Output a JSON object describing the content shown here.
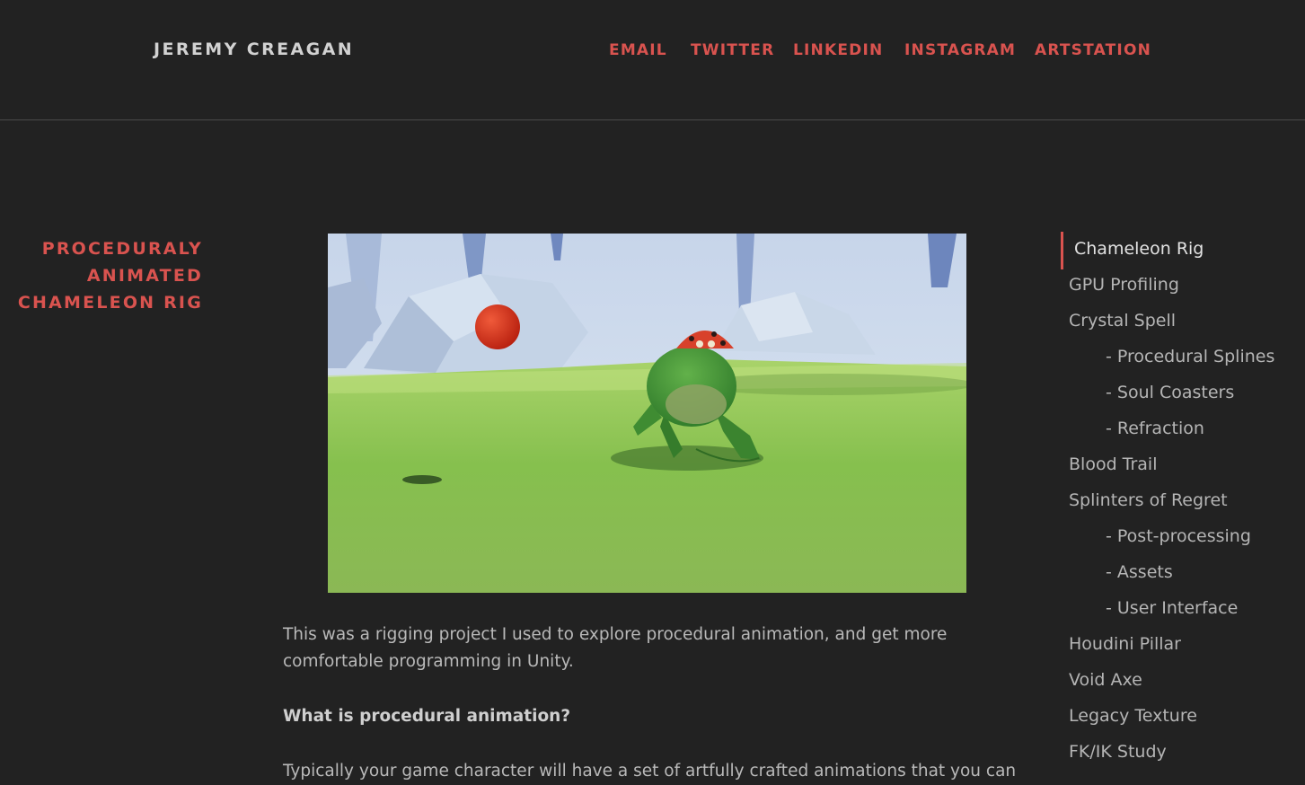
{
  "header": {
    "site_title": "JEREMY CREAGAN",
    "nav": [
      "EMAIL",
      "TWITTER",
      "LINKEDIN",
      "INSTAGRAM",
      "ARTSTATION"
    ]
  },
  "page": {
    "heading_lines": [
      "PROCEDURALY",
      "ANIMATED",
      "CHAMELEON RIG"
    ],
    "hero_image": "chameleon-rig-animation"
  },
  "article": {
    "intro": "This was a rigging project I used to explore procedural animation, and get more comfortable programming in Unity.",
    "question": "What is procedural animation?",
    "para2": "Typically your game character will have a set of artfully crafted animations that you can"
  },
  "toc": {
    "items": [
      {
        "label": "Chameleon Rig",
        "sub": false,
        "active": true
      },
      {
        "label": "GPU Profiling",
        "sub": false,
        "active": false
      },
      {
        "label": "Crystal Spell",
        "sub": false,
        "active": false
      },
      {
        "label": "- Procedural Splines",
        "sub": true,
        "active": false
      },
      {
        "label": "- Soul Coasters",
        "sub": true,
        "active": false
      },
      {
        "label": "- Refraction",
        "sub": true,
        "active": false
      },
      {
        "label": "Blood Trail",
        "sub": false,
        "active": false
      },
      {
        "label": "Splinters of Regret",
        "sub": false,
        "active": false
      },
      {
        "label": "- Post-processing",
        "sub": true,
        "active": false
      },
      {
        "label": "- Assets",
        "sub": true,
        "active": false
      },
      {
        "label": "- User Interface",
        "sub": true,
        "active": false
      },
      {
        "label": "Houdini Pillar",
        "sub": false,
        "active": false
      },
      {
        "label": "Void Axe",
        "sub": false,
        "active": false
      },
      {
        "label": "Legacy Texture",
        "sub": false,
        "active": false
      },
      {
        "label": "FK/IK Study",
        "sub": false,
        "active": false
      }
    ]
  },
  "colors": {
    "background": "#222222",
    "accent": "#d9534f",
    "text": "#b9b9b9"
  }
}
